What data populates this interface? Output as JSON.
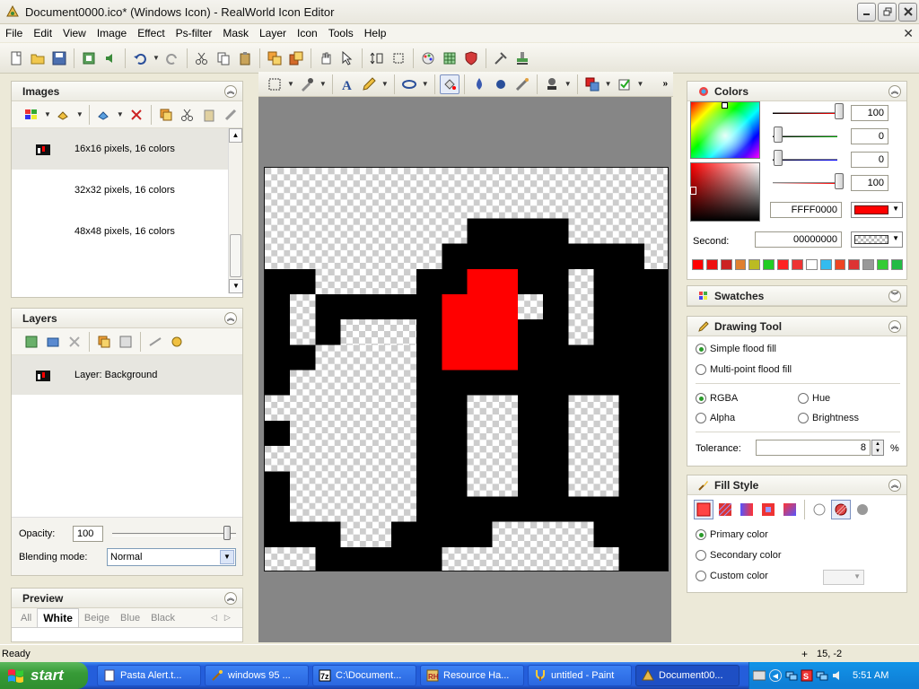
{
  "window": {
    "title": "Document0000.ico* (Windows Icon) - RealWorld Icon Editor"
  },
  "menu": [
    "File",
    "Edit",
    "View",
    "Image",
    "Effect",
    "Ps-filter",
    "Mask",
    "Layer",
    "Icon",
    "Tools",
    "Help"
  ],
  "images_panel": {
    "title": "Images",
    "items": [
      {
        "label": "16x16 pixels, 16 colors"
      },
      {
        "label": "32x32 pixels, 16 colors"
      },
      {
        "label": "48x48 pixels, 16 colors"
      }
    ]
  },
  "layers_panel": {
    "title": "Layers",
    "items": [
      {
        "label": "Layer: Background"
      }
    ],
    "opacity_label": "Opacity:",
    "opacity_value": "100",
    "blend_label": "Blending mode:",
    "blend_value": "Normal"
  },
  "preview_panel": {
    "title": "Preview",
    "tabs": [
      "All",
      "White",
      "Beige",
      "Blue",
      "Black"
    ],
    "selected_tab": "White"
  },
  "colors_panel": {
    "title": "Colors",
    "channel_values": [
      "100",
      "0",
      "0",
      "100"
    ],
    "primary_hex": "FFFF0000",
    "second_label": "Second:",
    "second_hex": "00000000",
    "primary_color": "#ff0000",
    "palette": [
      "#ff0000",
      "#ee1111",
      "#cc2222",
      "#e08030",
      "#bbbb22",
      "#22cc22",
      "#ff2222",
      "#ee3333",
      "#ffffff",
      "#33bbee",
      "#ee4422",
      "#dd3333",
      "#999999",
      "#33cc33",
      "#22bb44"
    ]
  },
  "swatches_panel": {
    "title": "Swatches"
  },
  "drawing_tool_panel": {
    "title": "Drawing Tool",
    "fill_options": [
      {
        "label": "Simple flood fill",
        "selected": true
      },
      {
        "label": "Multi-point flood fill",
        "selected": false
      }
    ],
    "mode_options": [
      {
        "label": "RGBA",
        "selected": true
      },
      {
        "label": "Hue",
        "selected": false
      },
      {
        "label": "Alpha",
        "selected": false
      },
      {
        "label": "Brightness",
        "selected": false
      }
    ],
    "tolerance_label": "Tolerance:",
    "tolerance_value": "8",
    "tolerance_unit": "%"
  },
  "fill_style_panel": {
    "title": "Fill Style",
    "options": [
      {
        "label": "Primary color",
        "selected": true
      },
      {
        "label": "Secondary color",
        "selected": false
      },
      {
        "label": "Custom color",
        "selected": false
      }
    ]
  },
  "status": {
    "left": "Ready",
    "coords": "15, -2"
  },
  "taskbar": {
    "start_label": "start",
    "tasks": [
      {
        "label": "Pasta Alert.t...",
        "active": false
      },
      {
        "label": "windows 95 ...",
        "active": false
      },
      {
        "label": "C:\\Document...",
        "active": false
      },
      {
        "label": "Resource Ha...",
        "active": false
      },
      {
        "label": "untitled - Paint",
        "active": false
      },
      {
        "label": "Document00...",
        "active": true
      }
    ],
    "clock": "5:51 AM"
  }
}
